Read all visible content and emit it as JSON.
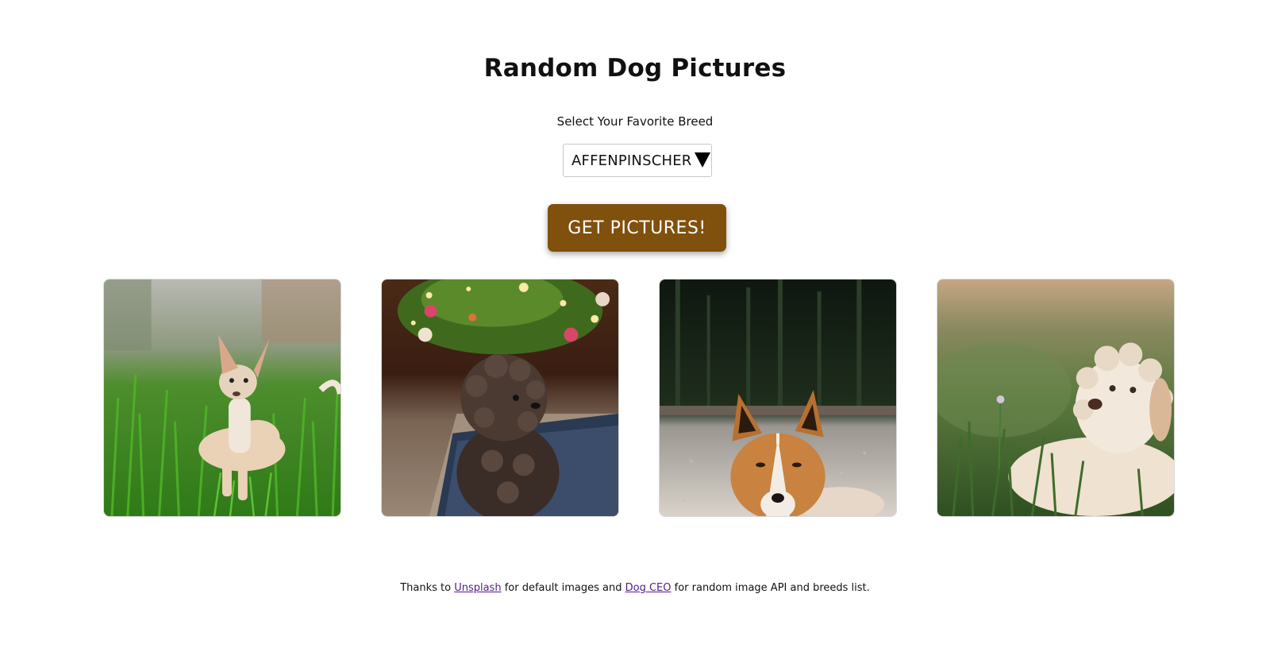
{
  "header": {
    "title": "Random Dog Pictures"
  },
  "breed_picker": {
    "label": "Select Your Favorite Breed",
    "selected": "AFFENPINSCHER",
    "caret_icon": "triangle-down-icon"
  },
  "action": {
    "button_label": "GET PICTURES!",
    "button_color": "#80500d"
  },
  "gallery": {
    "photos": [
      {
        "subject": "chihuahua-in-grass"
      },
      {
        "subject": "curly-poodle-by-christmas-tree"
      },
      {
        "subject": "shiba-like-dog-lying-on-sand"
      },
      {
        "subject": "white-doodle-in-grass"
      }
    ]
  },
  "footer": {
    "text_1": "Thanks to",
    "link_1": "Unsplash",
    "text_2": "for default images and",
    "link_2": "Dog CEO",
    "text_3": "for random image API and breeds list.",
    "link_color": "#551a8b"
  }
}
